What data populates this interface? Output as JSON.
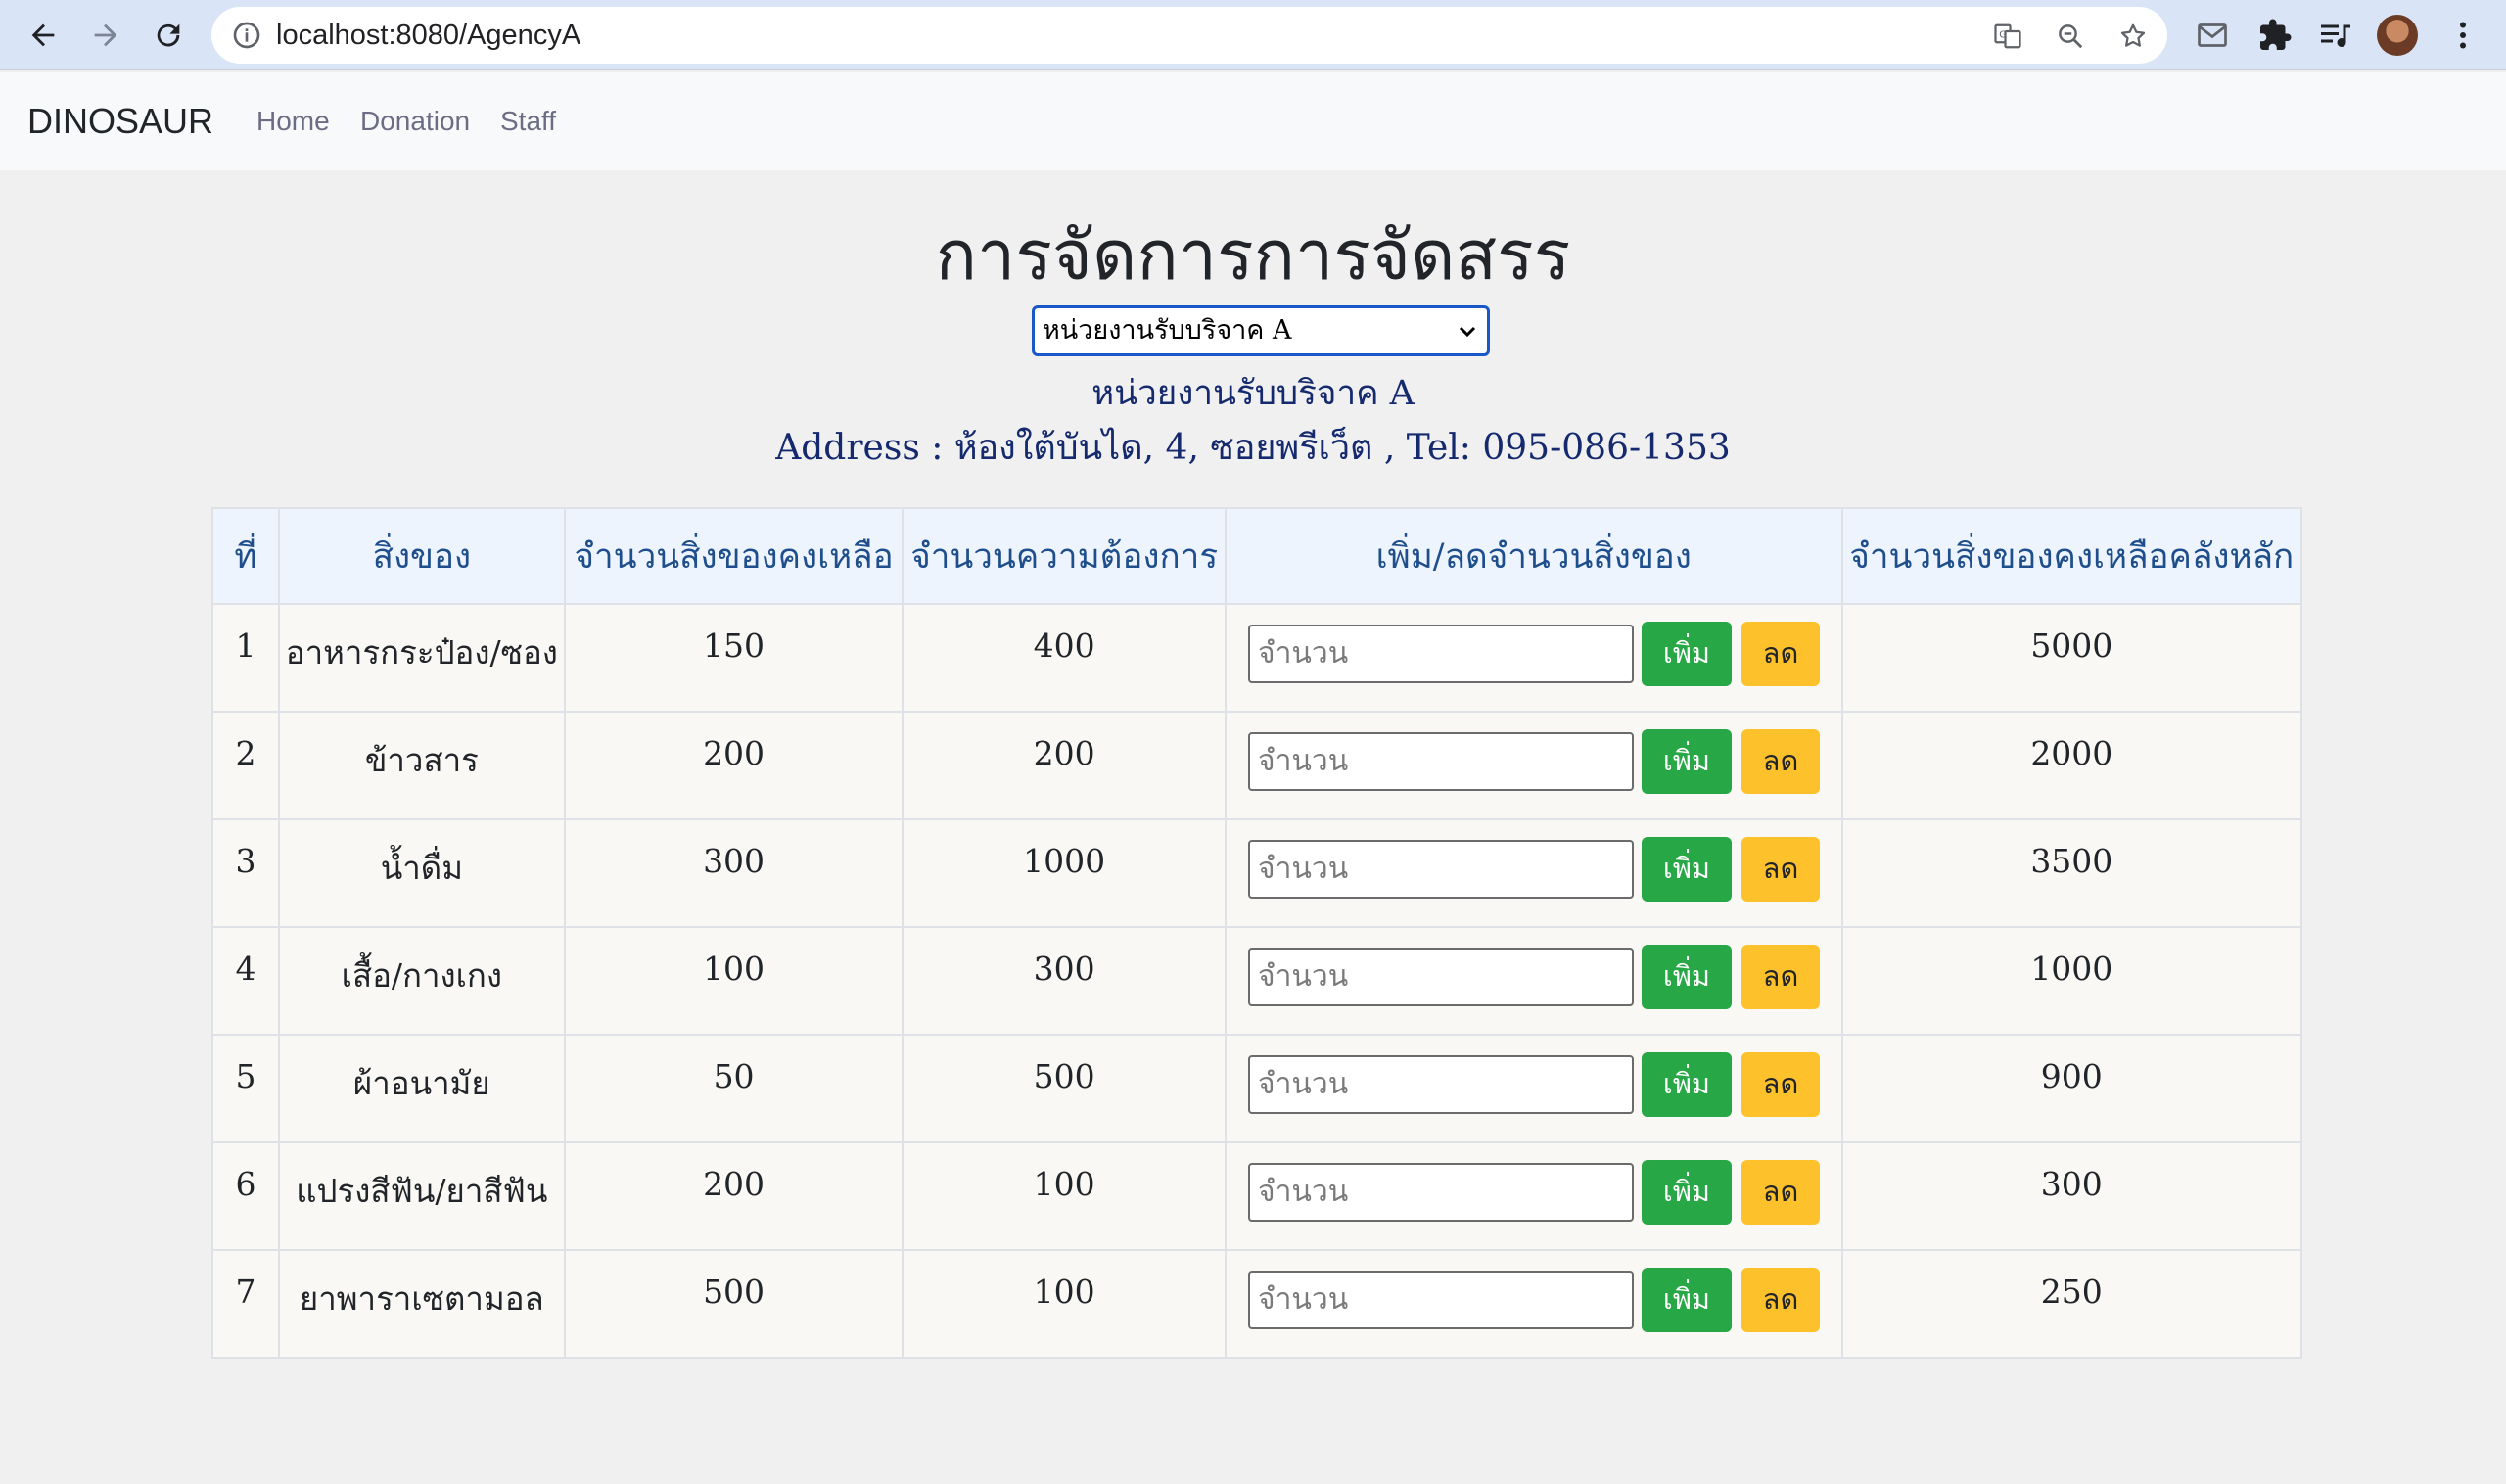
{
  "browser": {
    "url": "localhost:8080/AgencyA"
  },
  "navbar": {
    "brand": "DINOSAUR",
    "links": [
      "Home",
      "Donation",
      "Staff"
    ]
  },
  "page": {
    "title": "การจัดการการจัดสรร",
    "select_value": "หน่วยงานรับบริจาค A",
    "agency_name": "หน่วยงานรับบริจาค A",
    "agency_address": "Address : ห้องใต้บันได, 4, ซอยพรีเว็ต , Tel: 095-086-1353"
  },
  "table": {
    "headers": [
      "ที่",
      "สิ่งของ",
      "จำนวนสิ่งของคงเหลือ",
      "จำนวนความต้องการ",
      "เพิ่ม/ลดจำนวนสิ่งของ",
      "จำนวนสิ่งของคงเหลือคลังหลัก"
    ],
    "input_placeholder": "จำนวน",
    "add_label": "เพิ่ม",
    "subtract_label": "ลด",
    "rows": [
      {
        "no": "1",
        "item": "อาหารกระป๋อง/ซอง",
        "remaining": "150",
        "demand": "400",
        "main_stock": "5000"
      },
      {
        "no": "2",
        "item": "ข้าวสาร",
        "remaining": "200",
        "demand": "200",
        "main_stock": "2000"
      },
      {
        "no": "3",
        "item": "น้ำดื่ม",
        "remaining": "300",
        "demand": "1000",
        "main_stock": "3500"
      },
      {
        "no": "4",
        "item": "เสื้อ/กางเกง",
        "remaining": "100",
        "demand": "300",
        "main_stock": "1000"
      },
      {
        "no": "5",
        "item": "ผ้าอนามัย",
        "remaining": "50",
        "demand": "500",
        "main_stock": "900"
      },
      {
        "no": "6",
        "item": "แปรงสีฟัน/ยาสีฟัน",
        "remaining": "200",
        "demand": "100",
        "main_stock": "300"
      },
      {
        "no": "7",
        "item": "ยาพาราเซตามอล",
        "remaining": "500",
        "demand": "100",
        "main_stock": "250"
      }
    ]
  }
}
